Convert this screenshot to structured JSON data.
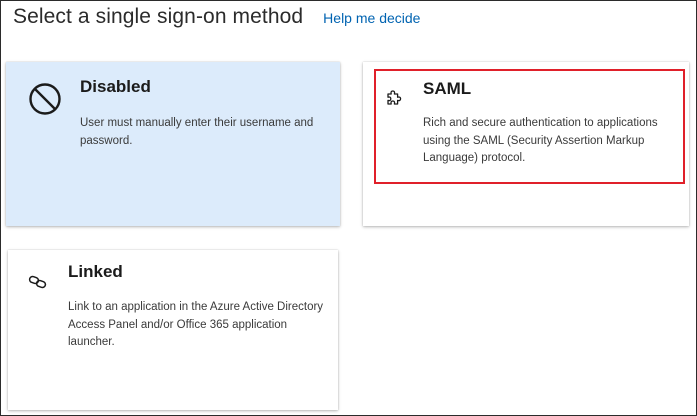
{
  "header": {
    "title": "Select a single sign-on method",
    "help_link": "Help me decide"
  },
  "methods": [
    {
      "title": "Disabled",
      "description": "User must manually enter their username and password.",
      "icon": "disabled-circle-icon",
      "selected": true
    },
    {
      "title": "SAML",
      "description": "Rich and secure authentication to applications using the SAML (Security Assertion Markup Language) protocol.",
      "icon": "puzzle-piece-icon",
      "selected": false,
      "highlighted": true
    },
    {
      "title": "Linked",
      "description": "Link to an application in the Azure Active Directory Access Panel and/or Office 365 application launcher.",
      "icon": "link-icon",
      "selected": false
    }
  ],
  "colors": {
    "selected_background": "#dcebfb",
    "link": "#0063b1",
    "highlight_border": "#e0202a"
  }
}
